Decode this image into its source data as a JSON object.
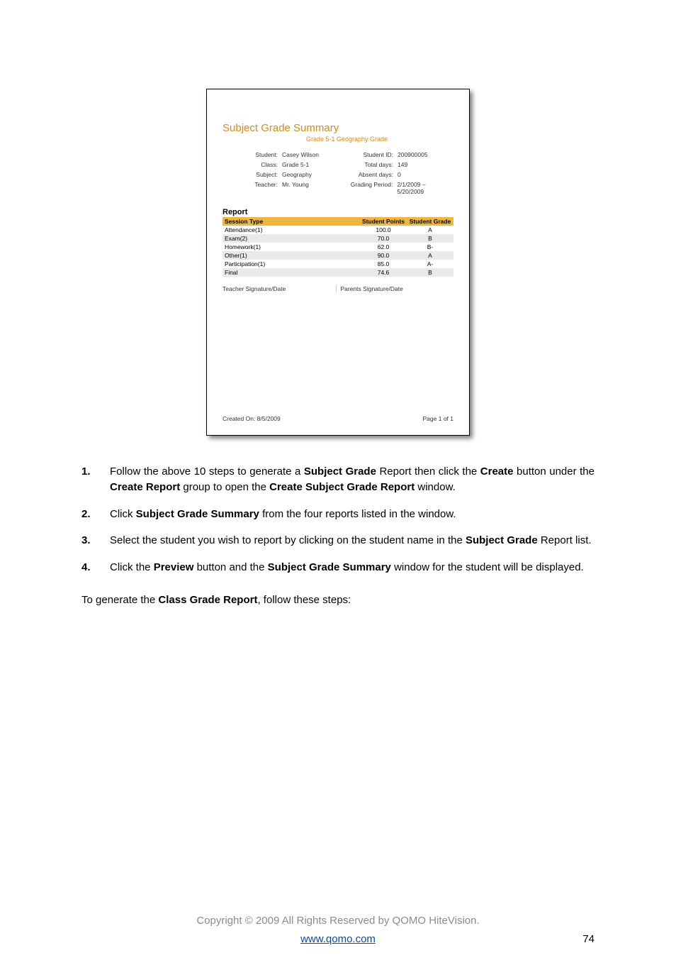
{
  "report": {
    "title": "Subject Grade Summary",
    "subtitle": "Grade 5-1 Geography Grade",
    "left": [
      {
        "label": "Student:",
        "value": "Casey Wilson"
      },
      {
        "label": "Class:",
        "value": "Grade 5-1"
      },
      {
        "label": "Subject:",
        "value": "Geography"
      },
      {
        "label": "Teacher:",
        "value": "Mr. Young"
      }
    ],
    "right": [
      {
        "label": "Student ID:",
        "value": "200900005"
      },
      {
        "label": "Total days:",
        "value": "149"
      },
      {
        "label": "Absent days:",
        "value": "0"
      },
      {
        "label": "Grading Period:",
        "value": "2/1/2009 – 5/20/2009"
      }
    ],
    "section": "Report",
    "cols": {
      "type": "Session Type",
      "points": "Student Points",
      "grade": "Student Grade"
    },
    "rows": [
      {
        "type": "Attendance(1)",
        "points": "100.0",
        "grade": "A"
      },
      {
        "type": "Exam(2)",
        "points": "70.0",
        "grade": "B"
      },
      {
        "type": "Homework(1)",
        "points": "62.0",
        "grade": "B-"
      },
      {
        "type": "Other(1)",
        "points": "90.0",
        "grade": "A"
      },
      {
        "type": "Participation(1)",
        "points": "85.0",
        "grade": "A-"
      },
      {
        "type": "Final",
        "points": "74.6",
        "grade": "B"
      }
    ],
    "sig1": "Teacher Signature/Date",
    "sig2": "Parents Signature/Date",
    "created": "Created On: 8/5/2009",
    "page": "Page 1 of 1"
  },
  "steps": [
    {
      "n": "1.",
      "a": "Follow the above 10 steps to generate a ",
      "b": "Subject Grade",
      "c": " Report then click the ",
      "d": "Create",
      "e": " button under the ",
      "f": "Create Report",
      "g": " group to open the ",
      "h": "Create Subject Grade Report",
      "i": " window."
    },
    {
      "n": "2.",
      "a": "Click ",
      "b": "Subject Grade Summary",
      "c": " from the four reports listed in the window."
    },
    {
      "n": "3.",
      "a": "Select the student you wish to report by clicking on the student name in the ",
      "b": "Subject Grade",
      "c": " Report list."
    },
    {
      "n": "4.",
      "a": "Click the ",
      "b": "Preview",
      "c": " button and the ",
      "d": "Subject Grade Summary",
      "e": " window for the student will be displayed."
    }
  ],
  "lastPara": {
    "a": "To generate the ",
    "b": "Class Grade Report",
    "c": ", follow these steps:"
  },
  "footer": {
    "copy": "Copyright © 2009 All Rights Reserved by QOMO HiteVision.",
    "url": "www.qomo.com",
    "page": "74"
  }
}
